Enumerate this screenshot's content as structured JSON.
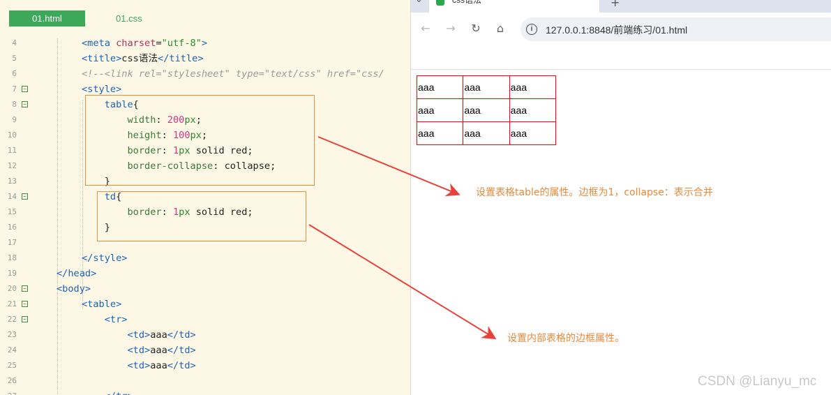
{
  "editor": {
    "tabs": [
      "01.html",
      "01.css"
    ],
    "lines": [
      {
        "n": "4",
        "fold": false,
        "tokens": [
          [
            "t",
            "<meta "
          ],
          [
            "a",
            "charset"
          ],
          [
            "x",
            "="
          ],
          [
            "s",
            "\"utf-8\""
          ],
          [
            "t",
            ">"
          ]
        ]
      },
      {
        "n": "5",
        "fold": false,
        "tokens": [
          [
            "t",
            "<title>"
          ],
          [
            "x",
            "css语法"
          ],
          [
            "t",
            "</title>"
          ]
        ]
      },
      {
        "n": "6",
        "fold": false,
        "tokens": [
          [
            "c",
            "<!--<link rel=\"stylesheet\" type=\"text/css\" href=\"css/"
          ]
        ]
      },
      {
        "n": "7",
        "fold": true,
        "tokens": [
          [
            "t",
            "<style>"
          ]
        ]
      },
      {
        "n": "8",
        "fold": true,
        "tokens": [
          [
            "x",
            "    "
          ],
          [
            "t",
            "table"
          ],
          [
            "x",
            "{"
          ]
        ]
      },
      {
        "n": "9",
        "fold": false,
        "tokens": [
          [
            "x",
            "        "
          ],
          [
            "p",
            "width"
          ],
          [
            "x",
            ": "
          ],
          [
            "n",
            "200"
          ],
          [
            "u",
            "px"
          ],
          [
            "x",
            ";"
          ]
        ]
      },
      {
        "n": "10",
        "fold": false,
        "tokens": [
          [
            "x",
            "        "
          ],
          [
            "p",
            "height"
          ],
          [
            "x",
            ": "
          ],
          [
            "n",
            "100"
          ],
          [
            "u",
            "px"
          ],
          [
            "x",
            ";"
          ]
        ]
      },
      {
        "n": "11",
        "fold": false,
        "tokens": [
          [
            "x",
            "        "
          ],
          [
            "p",
            "border"
          ],
          [
            "x",
            ": "
          ],
          [
            "n",
            "1"
          ],
          [
            "u",
            "px"
          ],
          [
            "v",
            " solid red"
          ],
          [
            "x",
            ";"
          ]
        ]
      },
      {
        "n": "12",
        "fold": false,
        "tokens": [
          [
            "x",
            "        "
          ],
          [
            "p",
            "border-collapse"
          ],
          [
            "x",
            ": "
          ],
          [
            "v",
            "collapse"
          ],
          [
            "x",
            ";"
          ]
        ]
      },
      {
        "n": "13",
        "fold": false,
        "tokens": [
          [
            "x",
            "    }"
          ]
        ]
      },
      {
        "n": "14",
        "fold": true,
        "tokens": [
          [
            "x",
            "    "
          ],
          [
            "t",
            "td"
          ],
          [
            "x",
            "{"
          ]
        ]
      },
      {
        "n": "15",
        "fold": false,
        "tokens": [
          [
            "x",
            "        "
          ],
          [
            "p",
            "border"
          ],
          [
            "x",
            ": "
          ],
          [
            "n",
            "1"
          ],
          [
            "u",
            "px"
          ],
          [
            "v",
            " solid red"
          ],
          [
            "x",
            ";"
          ]
        ]
      },
      {
        "n": "16",
        "fold": false,
        "tokens": [
          [
            "x",
            "    }"
          ]
        ]
      },
      {
        "n": "17",
        "fold": false,
        "tokens": []
      },
      {
        "n": "18",
        "fold": false,
        "tokens": [
          [
            "t",
            "</style>"
          ]
        ]
      },
      {
        "n": "19",
        "fold": false,
        "indent": -1,
        "tokens": [
          [
            "t",
            "</head>"
          ]
        ]
      },
      {
        "n": "20",
        "fold": true,
        "indent": -1,
        "tokens": [
          [
            "t",
            "<body>"
          ]
        ]
      },
      {
        "n": "21",
        "fold": true,
        "tokens": [
          [
            "t",
            "<table>"
          ]
        ]
      },
      {
        "n": "22",
        "fold": true,
        "tokens": [
          [
            "x",
            "    "
          ],
          [
            "t",
            "<tr>"
          ]
        ]
      },
      {
        "n": "23",
        "fold": false,
        "tokens": [
          [
            "x",
            "        "
          ],
          [
            "t",
            "<td>"
          ],
          [
            "x",
            "aaa"
          ],
          [
            "t",
            "</td>"
          ]
        ]
      },
      {
        "n": "24",
        "fold": false,
        "tokens": [
          [
            "x",
            "        "
          ],
          [
            "t",
            "<td>"
          ],
          [
            "x",
            "aaa"
          ],
          [
            "t",
            "</td>"
          ]
        ]
      },
      {
        "n": "25",
        "fold": false,
        "tokens": [
          [
            "x",
            "        "
          ],
          [
            "t",
            "<td>"
          ],
          [
            "x",
            "aaa"
          ],
          [
            "t",
            "</td>"
          ]
        ]
      },
      {
        "n": "26",
        "fold": false,
        "tokens": []
      },
      {
        "n": "27",
        "fold": false,
        "tokens": [
          [
            "x",
            "    "
          ],
          [
            "t",
            "</tr>"
          ]
        ]
      }
    ]
  },
  "browser": {
    "tab_title": "css语法",
    "tab_close": "×",
    "new_tab": "+",
    "url": "127.0.0.1:8848/前端练习/01.html",
    "nav": {
      "back": "←",
      "forward": "→",
      "reload": "↻",
      "home": "⌂",
      "info": "i"
    },
    "table_rows": [
      [
        "aaa",
        "aaa",
        "aaa"
      ],
      [
        "aaa",
        "aaa",
        "aaa"
      ],
      [
        "aaa",
        "aaa",
        "aaa"
      ]
    ]
  },
  "annotations": {
    "table_note": "设置表格table的属性。边框为1，collapse：表示合并",
    "td_note": "设置内部表格的边框属性。"
  },
  "watermark": "CSDN @Lianyu_mc",
  "colors": {
    "accent": "#3ea85a",
    "annotation": "#e7893a",
    "arrow": "#e8413a",
    "table_border": "#ff0000"
  }
}
